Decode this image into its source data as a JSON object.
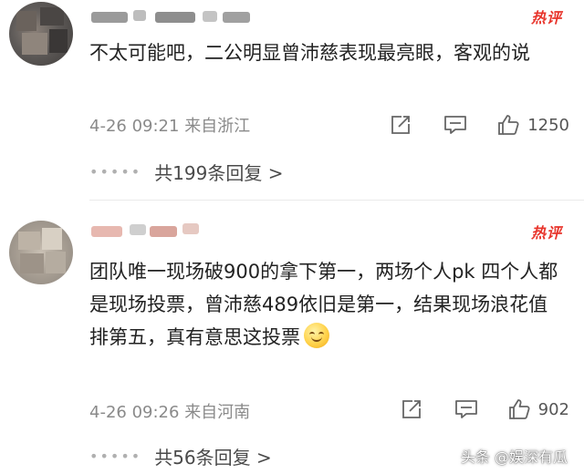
{
  "comments": [
    {
      "hot_badge": "热评",
      "content": "不太可能吧，二公明显曾沛慈表现最亮眼，客观的说",
      "time": "4-26 09:21",
      "location": "来自浙江",
      "likes": "1250",
      "replies_label": "共199条回复 >"
    },
    {
      "hot_badge": "热评",
      "content": "团队唯一现场破900的拿下第一，两场个人pk 四个人都是现场投票，曾沛慈489依旧是第一，结果现场浪花值排第五，真有意思这投票",
      "time": "4-26 09:26",
      "location": "来自河南",
      "likes": "902",
      "replies_label": "共56条回复 >"
    }
  ],
  "watermark": "头条 @娱深有瓜",
  "icons": {
    "share": "share-icon",
    "comment": "comment-icon",
    "like": "thumbs-up-icon"
  },
  "colors": {
    "hot_badge": "#e8342b",
    "meta_text": "#8a8a8a"
  }
}
